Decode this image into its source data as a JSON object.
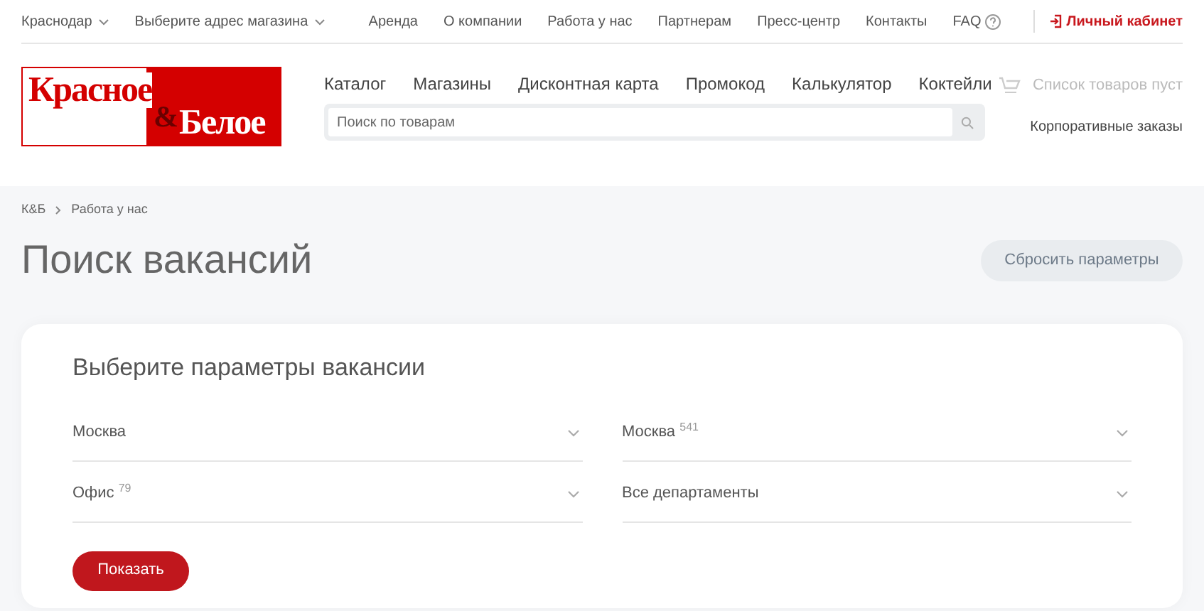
{
  "top_bar": {
    "city": "Краснодар",
    "store": "Выберите адрес магазина",
    "links": [
      "Аренда",
      "О компании",
      "Работа у нас",
      "Партнерам",
      "Пресс-центр",
      "Контакты"
    ],
    "faq": "FAQ",
    "account": "Личный кабинет"
  },
  "logo": {
    "line1": "Красное",
    "amp": "&",
    "line2": "Белое"
  },
  "nav": [
    "Каталог",
    "Магазины",
    "Дисконтная карта",
    "Промокод",
    "Калькулятор",
    "Коктейли"
  ],
  "search": {
    "placeholder": "Поиск по товарам"
  },
  "cart": "Список товаров пуст",
  "corporate": "Корпоративные заказы",
  "breadcrumbs": [
    "К&Б",
    "Работа у нас"
  ],
  "title": "Поиск вакансий",
  "reset_button": "Сбросить параметры",
  "filters": {
    "title": "Выберите параметры вакансии",
    "fields": [
      {
        "value": "Москва"
      },
      {
        "value": "Москва",
        "count": "541"
      },
      {
        "value": "Офис",
        "count": "79"
      },
      {
        "value": "Все департаменты"
      }
    ],
    "submit": "Показать"
  }
}
